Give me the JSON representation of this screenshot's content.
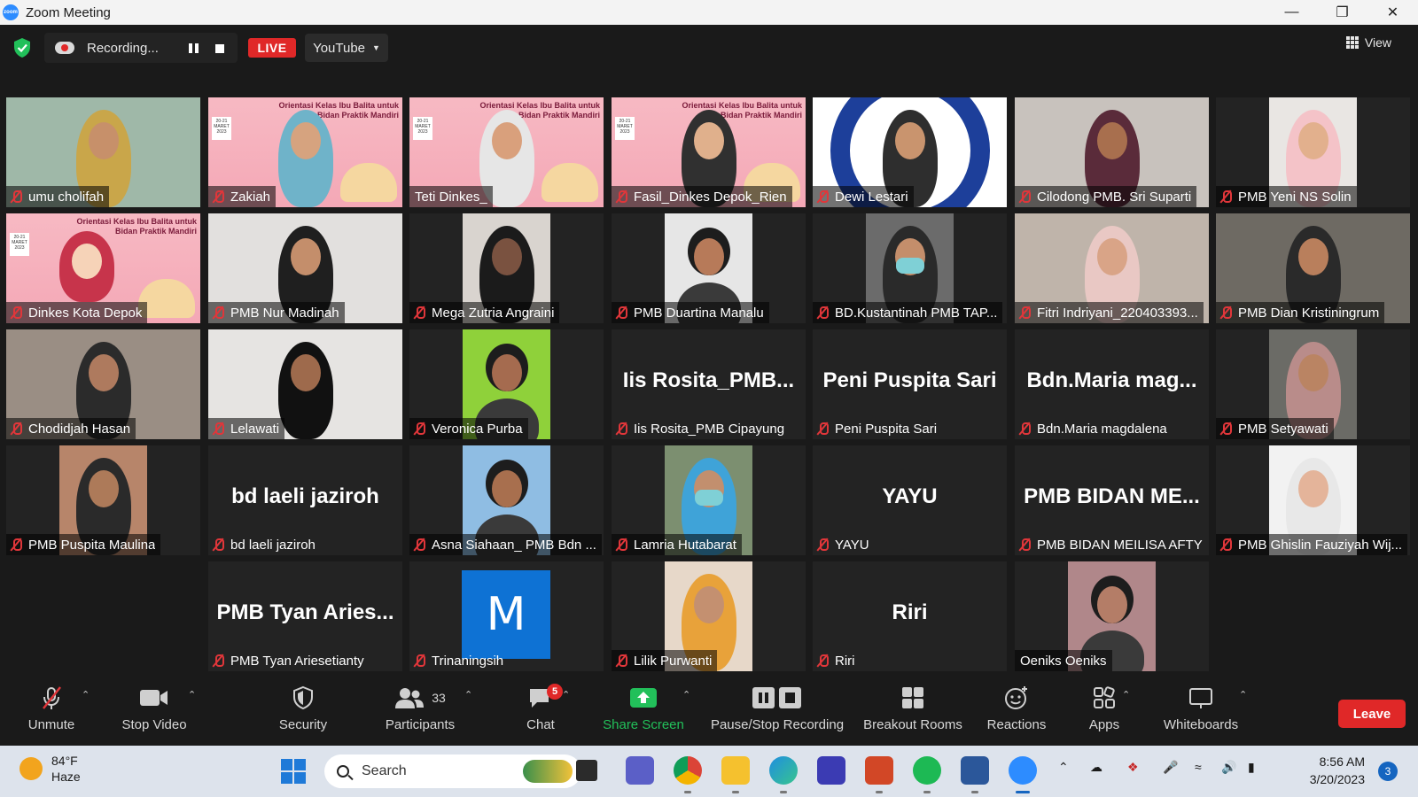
{
  "window": {
    "title": "Zoom Meeting"
  },
  "topbar": {
    "recording_text": "Recording...",
    "live_label": "LIVE",
    "stream_target": "YouTube",
    "view_label": "View"
  },
  "banner_text": "Orientasi Kelas Ibu Balita untuk Bidan Praktik Mandiri",
  "banner_date": "20-21 MARET 2023",
  "participants": [
    {
      "name": "umu cholifah",
      "muted": true,
      "video": true
    },
    {
      "name": "Zakiah",
      "muted": true,
      "video": true
    },
    {
      "name": "Teti Dinkes_",
      "muted": false,
      "video": true,
      "active_speaker": true
    },
    {
      "name": "Fasil_Dinkes Depok_Rien",
      "muted": true,
      "video": true
    },
    {
      "name": "Dewi Lestari",
      "muted": true,
      "video": true
    },
    {
      "name": "Cilodong PMB. Sri Suparti",
      "muted": true,
      "video": true
    },
    {
      "name": "PMB Yeni NS Solin",
      "muted": true,
      "video": true
    },
    {
      "name": "Dinkes Kota Depok",
      "muted": true,
      "video": true
    },
    {
      "name": "PMB Nur Madinah",
      "muted": true,
      "video": true
    },
    {
      "name": "Mega Zutria Angraini",
      "muted": true,
      "video": true
    },
    {
      "name": "PMB Duartina Manalu",
      "muted": true,
      "video": true
    },
    {
      "name": "BD.Kustantinah PMB TAP...",
      "muted": true,
      "video": true
    },
    {
      "name": "Fitri Indriyani_220403393...",
      "muted": true,
      "video": true
    },
    {
      "name": "PMB Dian Kristiningrum",
      "muted": true,
      "video": true
    },
    {
      "name": "Chodidjah Hasan",
      "muted": true,
      "video": true
    },
    {
      "name": "Lelawati",
      "muted": true,
      "video": true
    },
    {
      "name": "Veronica Purba",
      "muted": true,
      "video": true
    },
    {
      "name": "Iis Rosita_PMB Cipayung",
      "muted": true,
      "video": false,
      "display": "Iis  Rosita_PMB..."
    },
    {
      "name": "Peni Puspita Sari",
      "muted": true,
      "video": false,
      "display": "Peni Puspita Sari"
    },
    {
      "name": "Bdn.Maria magdalena",
      "muted": true,
      "video": false,
      "display": "Bdn.Maria  mag..."
    },
    {
      "name": "PMB Setyawati",
      "muted": true,
      "video": true
    },
    {
      "name": "PMB Puspita Maulina",
      "muted": true,
      "video": true
    },
    {
      "name": "bd laeli jaziroh",
      "muted": true,
      "video": false,
      "display": "bd laeli jaziroh"
    },
    {
      "name": "Asna Siahaan_ PMB Bdn ...",
      "muted": true,
      "video": true
    },
    {
      "name": "Lamria Hutabarat",
      "muted": true,
      "video": true
    },
    {
      "name": "YAYU",
      "muted": true,
      "video": false,
      "display": "YAYU"
    },
    {
      "name": "PMB BIDAN MEILISA AFTY",
      "muted": true,
      "video": false,
      "display": "PMB  BIDAN  ME..."
    },
    {
      "name": "PMB Ghislin Fauziyah Wij...",
      "muted": true,
      "video": true
    },
    {
      "name": "PMB Tyan Ariesetianty",
      "muted": true,
      "video": false,
      "display": "PMB  Tyan  Aries..."
    },
    {
      "name": "Trinaningsih",
      "muted": true,
      "video": false,
      "avatar_letter": "M"
    },
    {
      "name": "Lilik Purwanti",
      "muted": true,
      "video": true
    },
    {
      "name": "Riri",
      "muted": true,
      "video": false,
      "display": "Riri"
    },
    {
      "name": "Oeniks Oeniks",
      "muted": false,
      "video": true
    }
  ],
  "toolbar": {
    "unmute": "Unmute",
    "stop_video": "Stop Video",
    "security": "Security",
    "participants": "Participants",
    "participants_count": "33",
    "chat": "Chat",
    "chat_badge": "5",
    "share_screen": "Share Screen",
    "pause_stop_recording": "Pause/Stop Recording",
    "breakout_rooms": "Breakout Rooms",
    "reactions": "Reactions",
    "apps": "Apps",
    "whiteboards": "Whiteboards",
    "leave": "Leave"
  },
  "taskbar": {
    "temperature": "84°F",
    "weather": "Haze",
    "search_placeholder": "Search",
    "time": "8:56 AM",
    "date": "3/20/2023",
    "notification_count": "3"
  },
  "colors": {
    "live_red": "#e02828",
    "share_green": "#22c05a",
    "active_speaker": "#e8e04a",
    "mic_muted": "#e0363a",
    "zoom_blue": "#2d8cff"
  }
}
